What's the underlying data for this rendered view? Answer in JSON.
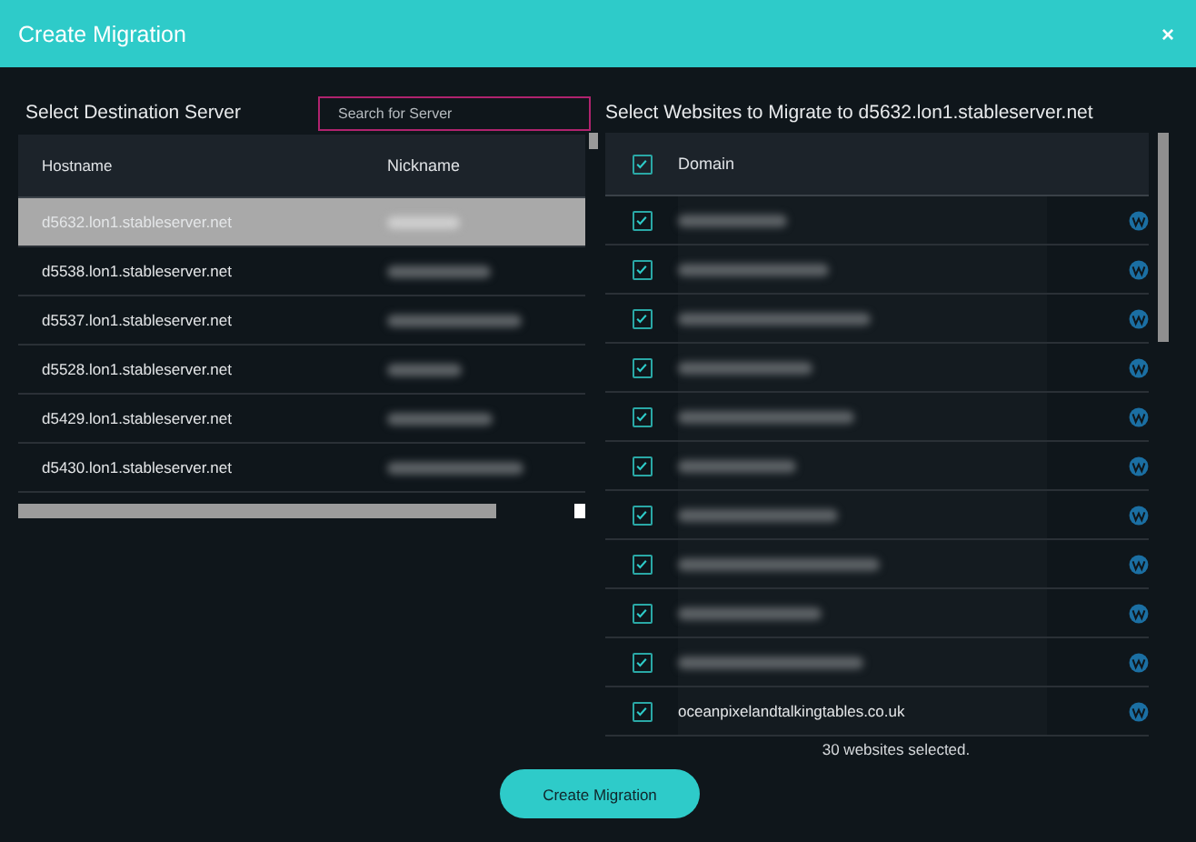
{
  "window": {
    "title": "Create Migration",
    "close": "×"
  },
  "servers": {
    "heading": "Select Destination Server",
    "search": {
      "placeholder": "Search for Server"
    },
    "columns": [
      "Hostname",
      "Nickname"
    ],
    "rows": [
      {
        "hostname": "d5632.lon1.stableserver.net",
        "selected": true
      },
      {
        "hostname": "d5538.lon1.stableserver.net",
        "selected": false
      },
      {
        "hostname": "d5537.lon1.stableserver.net",
        "selected": false
      },
      {
        "hostname": "d5528.lon1.stableserver.net",
        "selected": false
      },
      {
        "hostname": "d5429.lon1.stableserver.net",
        "selected": false
      },
      {
        "hostname": "d5430.lon1.stableserver.net",
        "selected": false
      }
    ]
  },
  "websites": {
    "heading": "Select Websites to Migrate to d5632.lon1.stableserver.net",
    "all_checked": true,
    "columns": [
      "Domain"
    ],
    "rows": [
      {
        "checked": true
      },
      {
        "checked": true
      },
      {
        "checked": true
      },
      {
        "checked": true
      },
      {
        "checked": true
      },
      {
        "checked": true
      },
      {
        "checked": true
      },
      {
        "checked": true
      },
      {
        "checked": true
      },
      {
        "checked": true
      },
      {
        "checked": true,
        "domain": "oceanpixelandtalkingtables.co.uk"
      }
    ],
    "summary": "30 websites selected."
  },
  "buttons": [
    "Create Migration"
  ]
}
